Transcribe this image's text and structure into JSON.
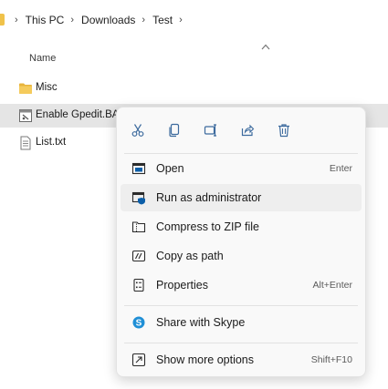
{
  "breadcrumb": {
    "items": [
      "This PC",
      "Downloads",
      "Test"
    ],
    "separator": "›"
  },
  "column_header": {
    "name_label": "Name",
    "sort_indicator": "^"
  },
  "files": [
    {
      "name": "Misc",
      "icon": "folder-icon",
      "selected": false
    },
    {
      "name": "Enable Gpedit.BA",
      "icon": "batch-file-icon",
      "selected": true
    },
    {
      "name": "List.txt",
      "icon": "text-file-icon",
      "selected": false
    }
  ],
  "context_menu": {
    "toolbar": [
      {
        "name": "cut",
        "icon": "scissors-icon"
      },
      {
        "name": "copy",
        "icon": "copy-icon"
      },
      {
        "name": "rename",
        "icon": "rename-icon"
      },
      {
        "name": "share",
        "icon": "share-icon"
      },
      {
        "name": "delete",
        "icon": "trash-icon"
      }
    ],
    "items": [
      {
        "label": "Open",
        "shortcut": "Enter",
        "icon": "open-icon"
      },
      {
        "label": "Run as administrator",
        "shortcut": "",
        "icon": "shield-run-icon",
        "hovered": true
      },
      {
        "label": "Compress to ZIP file",
        "shortcut": "",
        "icon": "zip-icon"
      },
      {
        "label": "Copy as path",
        "shortcut": "",
        "icon": "copy-path-icon"
      },
      {
        "label": "Properties",
        "shortcut": "Alt+Enter",
        "icon": "properties-icon"
      },
      {
        "label": "Share with Skype",
        "shortcut": "",
        "icon": "skype-icon"
      },
      {
        "label": "Show more options",
        "shortcut": "Shift+F10",
        "icon": "more-options-icon"
      }
    ]
  },
  "colors": {
    "accent": "#0b5ea8",
    "folder": "#f0c24a",
    "selected_row": "#e5e5e5",
    "menu_bg": "#f9f9f9"
  }
}
